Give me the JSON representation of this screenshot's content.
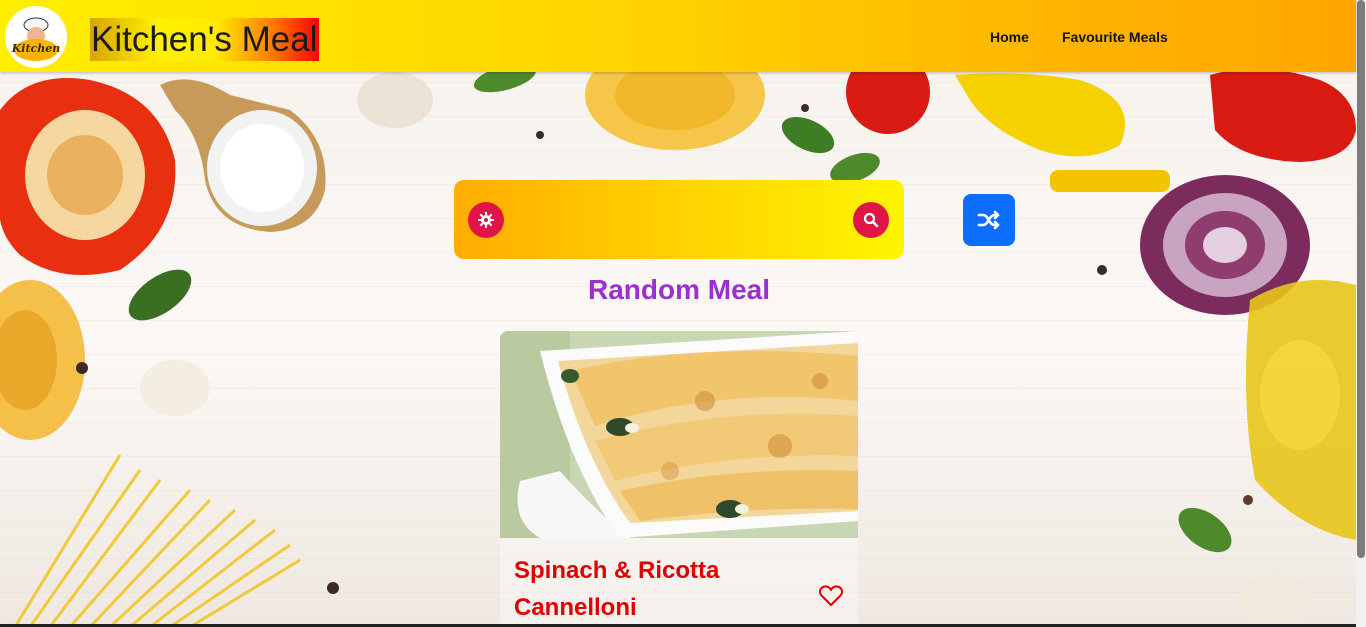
{
  "header": {
    "brand": "Kitchen's Meal",
    "logo_text": "Kitchen",
    "nav": {
      "home": "Home",
      "favourites": "Favourite Meals"
    }
  },
  "search": {
    "value": "",
    "placeholder": "",
    "settings_icon": "gear-icon",
    "submit_icon": "search-icon"
  },
  "random_button": {
    "icon": "shuffle-icon"
  },
  "random_meal": {
    "title": "Random Meal",
    "meal_name": "Spinach & Ricotta Cannelloni",
    "favourite_icon": "heart-outline-icon"
  },
  "colors": {
    "accent_red": "#e01446",
    "title_purple": "#9b2fcf",
    "meal_red": "#e00000",
    "random_blue": "#0d6efd"
  }
}
